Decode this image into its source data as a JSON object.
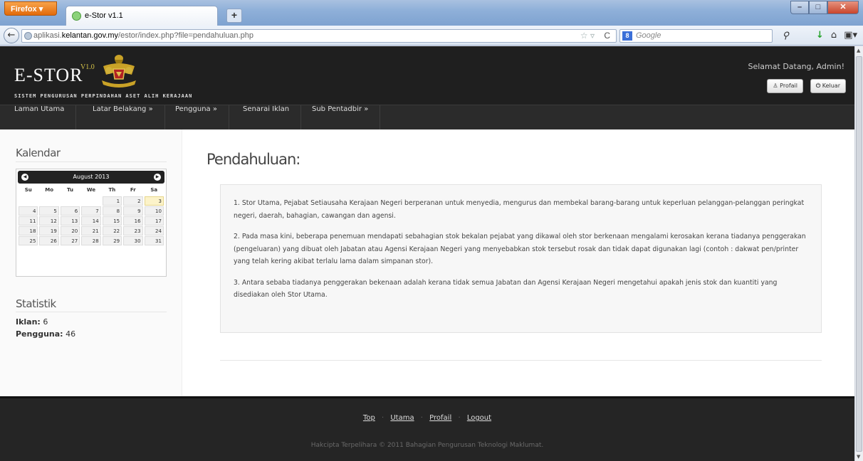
{
  "browser": {
    "menu_button": "Firefox ▾",
    "tab_title": "e-Stor v1.1",
    "new_tab": "+",
    "url_prefix": "aplikasi.",
    "url_domain": "kelantan.gov.my",
    "url_path": "/estor/index.php?file=pendahuluan.php",
    "search_placeholder": "Google",
    "search_engine_badge": "8"
  },
  "header": {
    "logo_text": "E-STOR",
    "logo_version": "V1.0",
    "subtitle": "SISTEM PENGURUSAN PERPINDAHAN ASET ALIH KERAJAAN",
    "welcome": "Selamat Datang, Admin!",
    "profile_button": "Profail",
    "logout_button": "Keluar"
  },
  "menu": [
    {
      "label": "Laman Utama"
    },
    {
      "label": "Latar Belakang »"
    },
    {
      "label": "Pengguna »"
    },
    {
      "label": "Senarai Iklan"
    },
    {
      "label": "Sub Pentadbir »"
    }
  ],
  "sidebar": {
    "calendar_title": "Kalendar",
    "calendar_month": "August 2013",
    "weekdays": [
      "Su",
      "Mo",
      "Tu",
      "We",
      "Th",
      "Fr",
      "Sa"
    ],
    "weeks": [
      [
        "",
        "",
        "",
        "",
        "1",
        "2",
        "3"
      ],
      [
        "4",
        "5",
        "6",
        "7",
        "8",
        "9",
        "10"
      ],
      [
        "11",
        "12",
        "13",
        "14",
        "15",
        "16",
        "17"
      ],
      [
        "18",
        "19",
        "20",
        "21",
        "22",
        "23",
        "24"
      ],
      [
        "25",
        "26",
        "27",
        "28",
        "29",
        "30",
        "31"
      ]
    ],
    "today": "3",
    "stats_title": "Statistik",
    "stats": [
      {
        "label": "Iklan:",
        "value": "6"
      },
      {
        "label": "Pengguna:",
        "value": "46"
      }
    ]
  },
  "main": {
    "title": "Pendahuluan:",
    "paragraphs": [
      "1. Stor Utama, Pejabat Setiausaha Kerajaan Negeri berperanan untuk menyedia, mengurus dan membekal barang-barang untuk keperluan pelanggan-pelanggan peringkat negeri, daerah, bahagian, cawangan dan agensi.",
      "2. Pada masa kini, beberapa penemuan mendapati sebahagian stok bekalan pejabat yang dikawal oleh stor berkenaan mengalami kerosakan kerana tiadanya penggerakan (pengeluaran) yang dibuat oleh Jabatan atau Agensi Kerajaan Negeri yang menyebabkan stok tersebut rosak dan tidak dapat digunakan lagi (contoh : dakwat pen/printer yang telah kering akibat terlalu lama dalam simpanan stor).",
      "3. Antara sebaba tiadanya penggerakan bekenaan adalah kerana tidak semua Jabatan dan Agensi Kerajaan Negeri mengetahui apakah jenis stok dan kuantiti yang disediakan oleh Stor Utama."
    ]
  },
  "footer": {
    "links": [
      "Top",
      "Utama",
      "Profail",
      "Logout"
    ],
    "separator": "·",
    "copyright": "Hakcipta Terpelihara © 2011 Bahagian Pengurusan Teknologi Maklumat."
  }
}
